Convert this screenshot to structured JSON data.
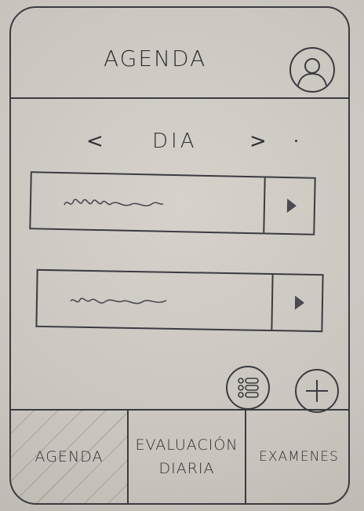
{
  "header": {
    "title": "AGENDA",
    "avatar_icon": "user-avatar-icon"
  },
  "day_nav": {
    "prev": "<",
    "label": "DIA",
    "next": ">"
  },
  "items": [
    {
      "icon": "chevron-right-icon"
    },
    {
      "icon": "chevron-right-icon"
    }
  ],
  "fabs": {
    "list_icon": "list-icon",
    "add_icon": "plus-icon"
  },
  "tabbar": {
    "agenda": "AGENDA",
    "evaluacion_line1": "EVALUACIÓN",
    "evaluacion_line2": "DIARIA",
    "examenes": "EXAMENES",
    "active": "AGENDA"
  }
}
